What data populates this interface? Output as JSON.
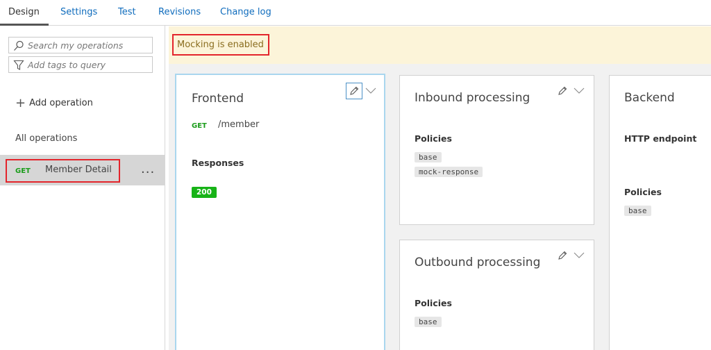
{
  "tabs": [
    {
      "label": "Design",
      "active": true
    },
    {
      "label": "Settings"
    },
    {
      "label": "Test"
    },
    {
      "label": "Revisions"
    },
    {
      "label": "Change log"
    }
  ],
  "sidebar": {
    "search_placeholder": "Search my operations",
    "tags_placeholder": "Add tags to query",
    "add_operation": "Add operation",
    "all_operations": "All operations",
    "operations": [
      {
        "method": "GET",
        "name": "Member Detail",
        "more": "..."
      }
    ]
  },
  "banner": {
    "text": "Mocking is enabled"
  },
  "frontend": {
    "title": "Frontend",
    "method": "GET",
    "path": "/member",
    "responses_label": "Responses",
    "responses": [
      "200"
    ]
  },
  "inbound": {
    "title": "Inbound processing",
    "policies_label": "Policies",
    "policies": [
      "base",
      "mock-response"
    ]
  },
  "outbound": {
    "title": "Outbound processing",
    "policies_label": "Policies",
    "policies": [
      "base"
    ]
  },
  "backend": {
    "title": "Backend",
    "endpoint_label": "HTTP endpoint",
    "policies_label": "Policies",
    "policies": [
      "base"
    ]
  },
  "colors": {
    "accent": "#0f6cbd",
    "get_method": "#1a9c1a",
    "response_badge": "#17b317",
    "highlight": "#e3242b",
    "banner_bg": "#fcf4d9"
  }
}
